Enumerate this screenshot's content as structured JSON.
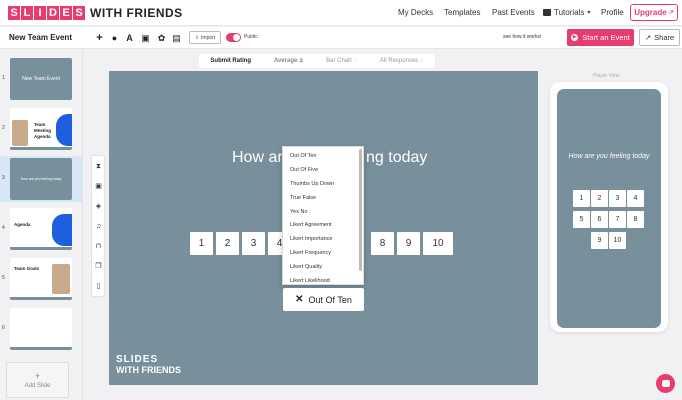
{
  "nav": {
    "logo_slides_letters": [
      "S",
      "L",
      "I",
      "D",
      "E",
      "S"
    ],
    "logo_friends": "WITH FRIENDS",
    "links": [
      "My Decks",
      "Templates",
      "Past Events",
      "Tutorials",
      "Profile"
    ],
    "upgrade": "Upgrade"
  },
  "toolbar": {
    "event_title": "New Team Event",
    "import_label": "Import",
    "public_label": "Public",
    "see_how": "see how it works!",
    "start_event": "Start an Event",
    "share": "Share"
  },
  "sidebar": {
    "slides": [
      {
        "num": "1",
        "caption": "New Team Event"
      },
      {
        "num": "2",
        "caption": "Team Meeting Agenda"
      },
      {
        "num": "3",
        "caption": "How are you feeling today"
      },
      {
        "num": "4",
        "caption": "Agenda"
      },
      {
        "num": "5",
        "caption": "Team Goals"
      },
      {
        "num": "6",
        "caption": ""
      }
    ],
    "add_slide": "Add Slide"
  },
  "view_tabs": [
    "Submit Rating",
    "Average",
    "Bar Chart",
    "All Responses"
  ],
  "slide": {
    "question_left": "How ar",
    "question_right": "ng today",
    "ratings_left": [
      "1",
      "2",
      "3",
      "4"
    ],
    "ratings_right": [
      "8",
      "9",
      "10"
    ],
    "logo_line1": "SLIDES",
    "logo_line2": "WITH FRIENDS"
  },
  "dropdown": {
    "options": [
      "Out Of Ten",
      "Out Of Five",
      "Thumbs Up Down",
      "True False",
      "Yes No",
      "Likert Agreement",
      "Likert Importance",
      "Likert Frequency",
      "Likert Quality",
      "Likert Likelihood"
    ],
    "selected": "Out Of Ten"
  },
  "player": {
    "label": "Player View",
    "question": "How are you feeling today",
    "rows": [
      [
        "1",
        "2",
        "3",
        "4"
      ],
      [
        "5",
        "6",
        "7",
        "8"
      ],
      [
        "9",
        "10"
      ]
    ]
  },
  "colors": {
    "accent": "#e63c6e",
    "slide_bg": "#78909c"
  }
}
